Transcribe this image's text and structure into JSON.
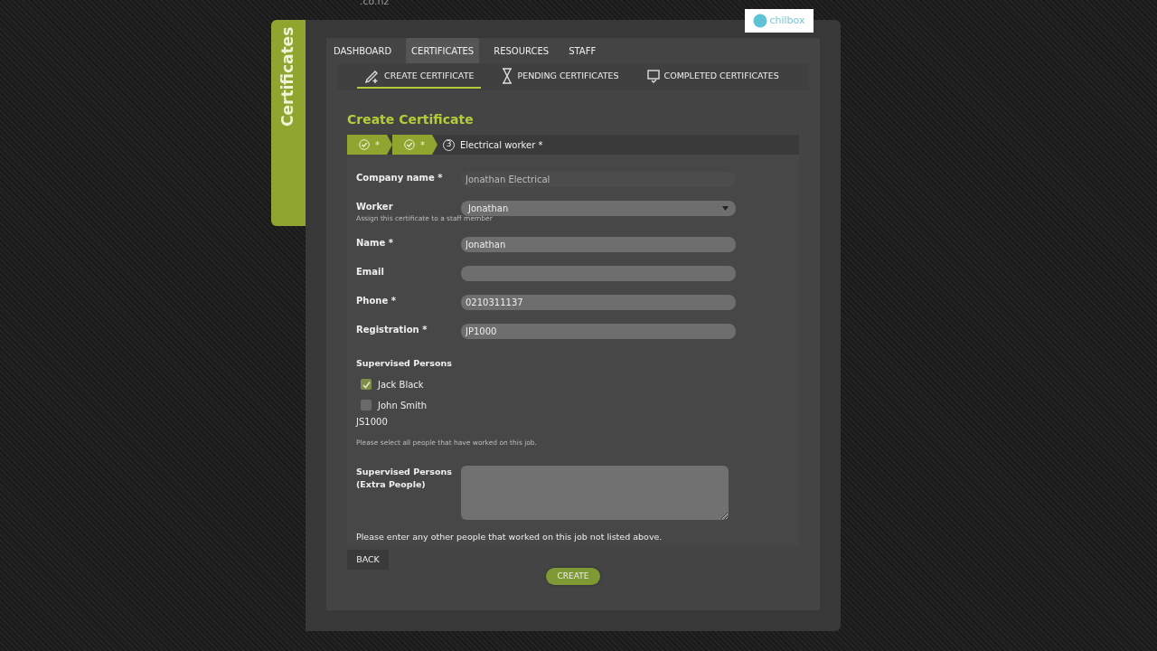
{
  "logo": {
    "suffix": ".co.nz"
  },
  "sidebar_tab": {
    "label": "Certificates"
  },
  "brand_badge": {
    "label": "chilbox"
  },
  "nav_tabs": [
    {
      "label": "DASHBOARD",
      "selected": false
    },
    {
      "label": "CERTIFICATES",
      "selected": true
    },
    {
      "label": "RESOURCES",
      "selected": false
    },
    {
      "label": "STAFF",
      "selected": false
    }
  ],
  "sub_tabs": [
    {
      "label": "CREATE CERTIFICATE",
      "selected": true
    },
    {
      "label": "PENDING CERTIFICATES",
      "selected": false
    },
    {
      "label": "COMPLETED CERTIFICATES",
      "selected": false
    }
  ],
  "heading": "Create Certificate",
  "steps": [
    {
      "kind": "done",
      "label": "*"
    },
    {
      "kind": "done",
      "label": "*"
    },
    {
      "kind": "current",
      "number": "3",
      "label": "Electrical worker *"
    }
  ],
  "fields": [
    {
      "kind": "text",
      "label": "Company name *",
      "value": "Jonathan Electrical",
      "disabled": true
    },
    {
      "kind": "select",
      "label": "Worker",
      "value": "Jonathan",
      "hint": "Assign this certificate to a staff member",
      "disabled": false
    },
    {
      "kind": "text",
      "label": "Name *",
      "value": "Jonathan",
      "disabled": false
    },
    {
      "kind": "text",
      "label": "Email",
      "disabled": false
    },
    {
      "kind": "text",
      "label": "Phone *",
      "value": "0210311137",
      "disabled": false
    },
    {
      "kind": "text",
      "label": "Registration *",
      "value": "JP1000",
      "disabled": false
    }
  ],
  "supervised": {
    "label": "Supervised Persons",
    "people": [
      {
        "name": "Jack Black",
        "checked": true
      },
      {
        "name": "John Smith",
        "checked": false,
        "note": "JS1000"
      }
    ],
    "hint": "Please select all people that have worked on this job."
  },
  "extra": {
    "label_lines": [
      "Supervised Persons",
      "(Extra People)"
    ],
    "hint": "Please enter any other people that worked on this job not listed above."
  },
  "buttons": {
    "back": "BACK",
    "create": "CREATE"
  }
}
